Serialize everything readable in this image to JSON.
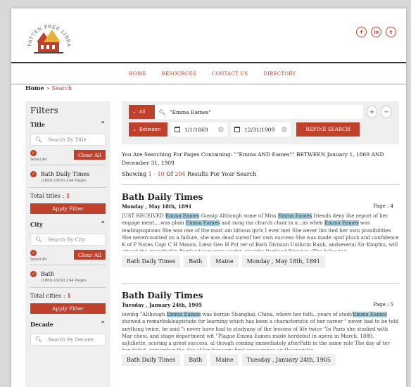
{
  "logo": {
    "text": "PATTEN FREE LIBRARY"
  },
  "social": [
    "f",
    "in",
    "t"
  ],
  "nav": [
    "HOME",
    "RESOURCES",
    "CONTACT US",
    "DIRECTORY"
  ],
  "breadcrumb": {
    "home": "Home",
    "sep": "›",
    "current": "Search"
  },
  "filters": {
    "title": "Filters",
    "sections": [
      {
        "label": "Title",
        "search_placeholder": "Search By Title",
        "select_all": "Select All",
        "clear": "Clear All",
        "option": {
          "label": "Bath Daily Times",
          "sub": "(1869-1909)  294 Pages"
        },
        "total_label": "Total titles : ",
        "total_value": "1",
        "apply": "Apply Filter"
      },
      {
        "label": "City",
        "search_placeholder": "Search By City",
        "select_all": "Select All",
        "clear": "Clear All",
        "option": {
          "label": "Bath",
          "sub": "(1869-1909)  294 Pages"
        },
        "total_label": "Total cities : ",
        "total_value": "1",
        "apply": "Apply Filter"
      },
      {
        "label": "Decade",
        "search_placeholder": "Search By Decade"
      }
    ]
  },
  "search": {
    "scope": "All",
    "query": "\"Emma Eames\"",
    "date_mode": "Between",
    "start_date": "1/1/1869",
    "end_date": "12/31/1909",
    "refine": "REFINE SEARCH",
    "plus": "+",
    "minus": "−"
  },
  "summary": {
    "text": "You Are Searching For Pages Containing: \"\"Emma AND Eames\"\" BETWEEN January 1, 1869 AND December 31, 1909",
    "showing_prefix": "Showing ",
    "range": "1 - 10",
    "of": " Of ",
    "total": "294",
    "suffix": " Results For Your Search"
  },
  "results": [
    {
      "title": "Bath Daily Times",
      "date": "Monday , May 18th, 1891",
      "page": "Page : 4",
      "snippet": "JUST RECEIVED [[Emma Eames]] Gossip Although some of Miss [[Emma Eames]] friends deny the report of her engage ment,...was plain [[Emma Eames]] and sung ina church choir in a...as when [[Emma Eames]] was leadingsoprano She was one of the most am bitious girls I ever met She never lim ited her own possibilities She nevercounted on a failure, she was dead sureof her own success She was made upof pluck and confidence K of P Notes Capt C H Mason, Lieut Geo H Pot ter of Bath Division Uniform Rank, andseveral Sir Knights, will attend the grandballin Portland tomorrow night, givenby Portland Division xThe following...",
      "tags": [
        "Bath Daily Times",
        "Bath",
        "Maine",
        "Monday , May 18th, 1891"
      ]
    },
    {
      "title": "Bath Daily Times",
      "date": "Tuesday , January 24th, 1905",
      "page": "Page : 5",
      "snippet": "lowing \"Although [[Emma Eames]] was bornin Shanghai, China, where her fath...years of study[[Emma Eames]] showed a remarkableaptitude for learning which has been a characteristic of her career \" never had to be told anything twice, he said \"i never have had to studyany of the lessons of life twice \"In Paris she studied with Mar chesi, and stage deportment wit \"Plague Emma Eames made herdebut in opera in March, 1889, asJuliette, scoring a great success, al though coming immediately afterPatti in the same role The day af ter her debut, remember the day af ter her very first appearance on theoperatic...",
      "tags": [
        "Bath Daily Times",
        "Bath",
        "Maine",
        "Tuesday , January 24th, 1905"
      ]
    }
  ],
  "colors": {
    "accent": "#c0412b",
    "highlight": "#9ecfe3",
    "panel": "#efefef"
  }
}
